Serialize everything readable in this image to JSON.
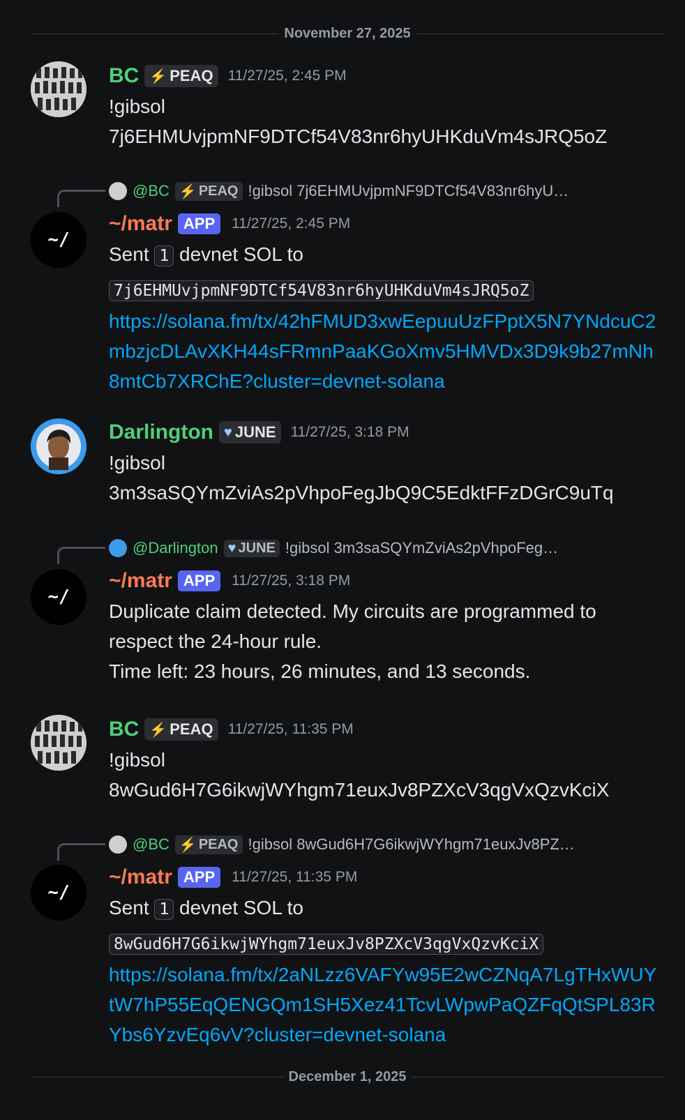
{
  "dates": {
    "first": "November 27, 2025",
    "second": "December 1, 2025"
  },
  "colors": {
    "background": "#111214",
    "user_name": "#4ed17a",
    "bot_name": "#ff7a52",
    "app_badge": "#5865f2",
    "link": "#00a8fc"
  },
  "msg1": {
    "author": "BC",
    "tag": "PEAQ",
    "tag_icon": "lightning-icon",
    "time": "11/27/25, 2:45 PM",
    "line1": "!gibsol",
    "line2": "7j6EHMUvjpmNF9DTCf54V83nr6hyUHKduVm4sJRQ5oZ"
  },
  "reply1": {
    "mention": "@BC",
    "tag": "PEAQ",
    "text": "!gibsol 7j6EHMUvjpmNF9DTCf54V83nr6hyU…"
  },
  "bot1": {
    "author": "~/matr",
    "badge": "APP",
    "avatar_text": "~/",
    "time": "11/27/25, 2:45 PM",
    "sent": "Sent",
    "amount": "1",
    "rest": "devnet SOL to",
    "address": "7j6EHMUvjpmNF9DTCf54V83nr6hyUHKduVm4sJRQ5oZ",
    "link": "https://solana.fm/tx/42hFMUD3xwEepuuUzFPptX5N7YNdcuC2mbzjcDLAvXKH44sFRmnPaaKGoXmv5HMVDx3D9k9b27mNh8mtCb7XRChE?cluster=devnet-solana"
  },
  "msg2": {
    "author": "Darlington",
    "tag": "JUNE",
    "tag_icon": "heart-icon",
    "time": "11/27/25, 3:18 PM",
    "line1": "!gibsol",
    "line2": "3m3saSQYmZviAs2pVhpoFegJbQ9C5EdktFFzDGrC9uTq"
  },
  "reply2": {
    "mention": "@Darlington",
    "tag": "JUNE",
    "text": "!gibsol 3m3saSQYmZviAs2pVhpoFeg…"
  },
  "bot2": {
    "author": "~/matr",
    "badge": "APP",
    "avatar_text": "~/",
    "time": "11/27/25, 3:18 PM",
    "line1": "Duplicate claim detected. My circuits are programmed to respect the 24-hour rule.",
    "line2": "Time left: 23 hours, 26 minutes, and 13 seconds."
  },
  "msg3": {
    "author": "BC",
    "tag": "PEAQ",
    "tag_icon": "lightning-icon",
    "time": "11/27/25, 11:35 PM",
    "line1": "!gibsol",
    "line2": "8wGud6H7G6ikwjWYhgm71euxJv8PZXcV3qgVxQzvKciX"
  },
  "reply3": {
    "mention": "@BC",
    "tag": "PEAQ",
    "text": "!gibsol 8wGud6H7G6ikwjWYhgm71euxJv8PZ…"
  },
  "bot3": {
    "author": "~/matr",
    "badge": "APP",
    "avatar_text": "~/",
    "time": "11/27/25, 11:35 PM",
    "sent": "Sent",
    "amount": "1",
    "rest": "devnet SOL to",
    "address": "8wGud6H7G6ikwjWYhgm71euxJv8PZXcV3qgVxQzvKciX",
    "link": "https://solana.fm/tx/2aNLzz6VAFYw95E2wCZNqA7LgTHxWUYtW7hP55EqQENGQm1SH5Xez41TcvLWpwPaQZFqQtSPL83RYbs6YzvEq6vV?cluster=devnet-solana"
  }
}
